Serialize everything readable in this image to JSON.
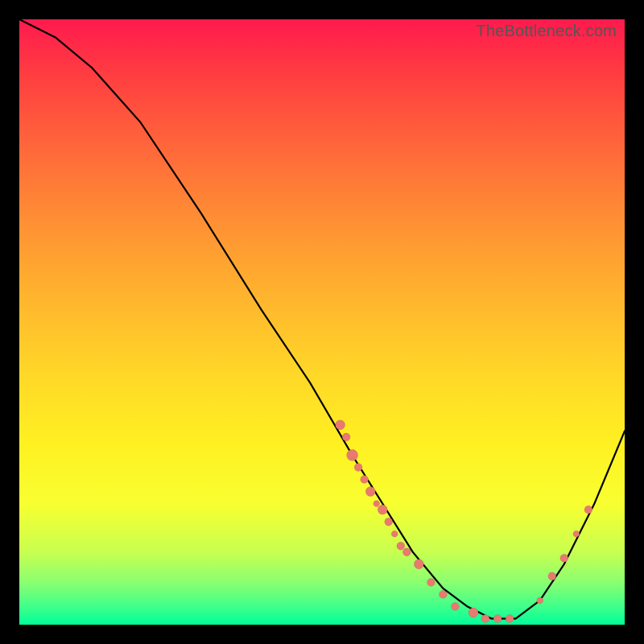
{
  "watermark": "TheBottleneck.com",
  "chart_data": {
    "type": "line",
    "title": "",
    "xlabel": "",
    "ylabel": "",
    "xlim": [
      0,
      100
    ],
    "ylim": [
      0,
      100
    ],
    "grid": false,
    "legend": false,
    "series": [
      {
        "name": "curve",
        "x": [
          0,
          6,
          12,
          20,
          30,
          40,
          48,
          55,
          60,
          65,
          70,
          74,
          78,
          82,
          86,
          90,
          95,
          100
        ],
        "y": [
          100,
          97,
          92,
          83,
          68,
          52,
          40,
          28,
          20,
          12,
          6,
          3,
          1,
          1,
          4,
          10,
          20,
          32
        ]
      }
    ],
    "scatter": [
      {
        "name": "dots",
        "points": [
          {
            "x": 53,
            "y": 33,
            "r": 6
          },
          {
            "x": 54,
            "y": 31,
            "r": 5
          },
          {
            "x": 55,
            "y": 28,
            "r": 7
          },
          {
            "x": 56,
            "y": 26,
            "r": 5
          },
          {
            "x": 57,
            "y": 24,
            "r": 5
          },
          {
            "x": 58,
            "y": 22,
            "r": 6
          },
          {
            "x": 59,
            "y": 20,
            "r": 4
          },
          {
            "x": 60,
            "y": 19,
            "r": 6
          },
          {
            "x": 61,
            "y": 17,
            "r": 5
          },
          {
            "x": 62,
            "y": 15,
            "r": 4
          },
          {
            "x": 63,
            "y": 13,
            "r": 5
          },
          {
            "x": 64,
            "y": 12,
            "r": 5
          },
          {
            "x": 66,
            "y": 10,
            "r": 6
          },
          {
            "x": 68,
            "y": 7,
            "r": 5
          },
          {
            "x": 70,
            "y": 5,
            "r": 5
          },
          {
            "x": 72,
            "y": 3,
            "r": 5
          },
          {
            "x": 75,
            "y": 2,
            "r": 6
          },
          {
            "x": 77,
            "y": 1,
            "r": 5
          },
          {
            "x": 79,
            "y": 1,
            "r": 5
          },
          {
            "x": 81,
            "y": 1,
            "r": 5
          },
          {
            "x": 86,
            "y": 4,
            "r": 4
          },
          {
            "x": 88,
            "y": 8,
            "r": 5
          },
          {
            "x": 90,
            "y": 11,
            "r": 5
          },
          {
            "x": 92,
            "y": 15,
            "r": 4
          },
          {
            "x": 94,
            "y": 19,
            "r": 5
          }
        ]
      }
    ]
  }
}
